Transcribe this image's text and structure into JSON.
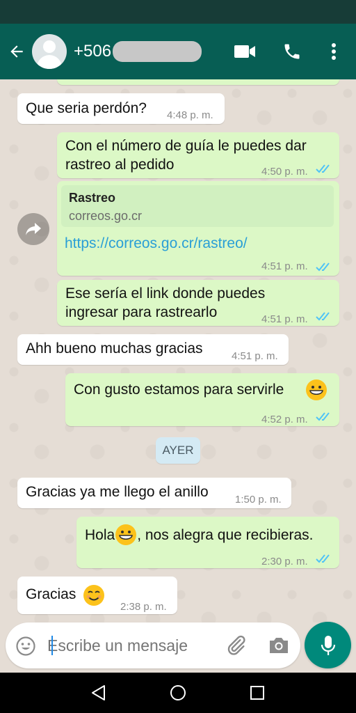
{
  "header": {
    "contact_prefix": "+506",
    "back_icon": "arrow-left-icon",
    "video_icon": "video-camera-icon",
    "call_icon": "phone-icon",
    "menu_icon": "more-vert-icon"
  },
  "messages": [
    {
      "dir": "in",
      "text": "Que seria perdón?",
      "time": "4:48 p. m."
    },
    {
      "dir": "out",
      "line1": "Con el número de guía le puedes dar",
      "line2": "rastreo al pedido",
      "time": "4:50 p. m.",
      "status": "read"
    },
    {
      "dir": "out",
      "preview_title": "Rastreo",
      "preview_domain": "correos.go.cr",
      "url": "https://correos.go.cr/rastreo/",
      "time": "4:51 p. m.",
      "status": "read"
    },
    {
      "dir": "out",
      "line1": "Ese sería el link donde puedes",
      "line2": "ingresar para rastrearlo",
      "time": "4:51 p. m.",
      "status": "read"
    },
    {
      "dir": "in",
      "text": "Ahh bueno muchas gracias",
      "time": "4:51 p. m."
    },
    {
      "dir": "out",
      "text": "Con gusto estamos para servirle",
      "emoji": "grinning-face",
      "time": "4:52 p. m.",
      "status": "read"
    },
    {
      "dir": "in",
      "text": "Gracias ya me llego el anillo",
      "time": "1:50 p. m."
    },
    {
      "dir": "out",
      "text_before": "Hola",
      "text_after": ", nos alegra que recibieras.",
      "emoji": "grinning-face",
      "time": "2:30 p. m.",
      "status": "read"
    },
    {
      "dir": "in",
      "text": "Gracias",
      "emoji": "smiling-face",
      "time": "2:38 p. m."
    }
  ],
  "date_separator": "AYER",
  "composer": {
    "placeholder": "Escribe un mensaje",
    "emoji_icon": "emoji-icon",
    "attach_icon": "paperclip-icon",
    "camera_icon": "camera-icon",
    "mic_icon": "microphone-icon"
  },
  "colors": {
    "header": "#075e54",
    "outgoing": "#dcf8c6",
    "incoming": "#ffffff",
    "read_ticks": "#4fc3f7",
    "link": "#2a9fd6",
    "fab": "#00897b"
  }
}
